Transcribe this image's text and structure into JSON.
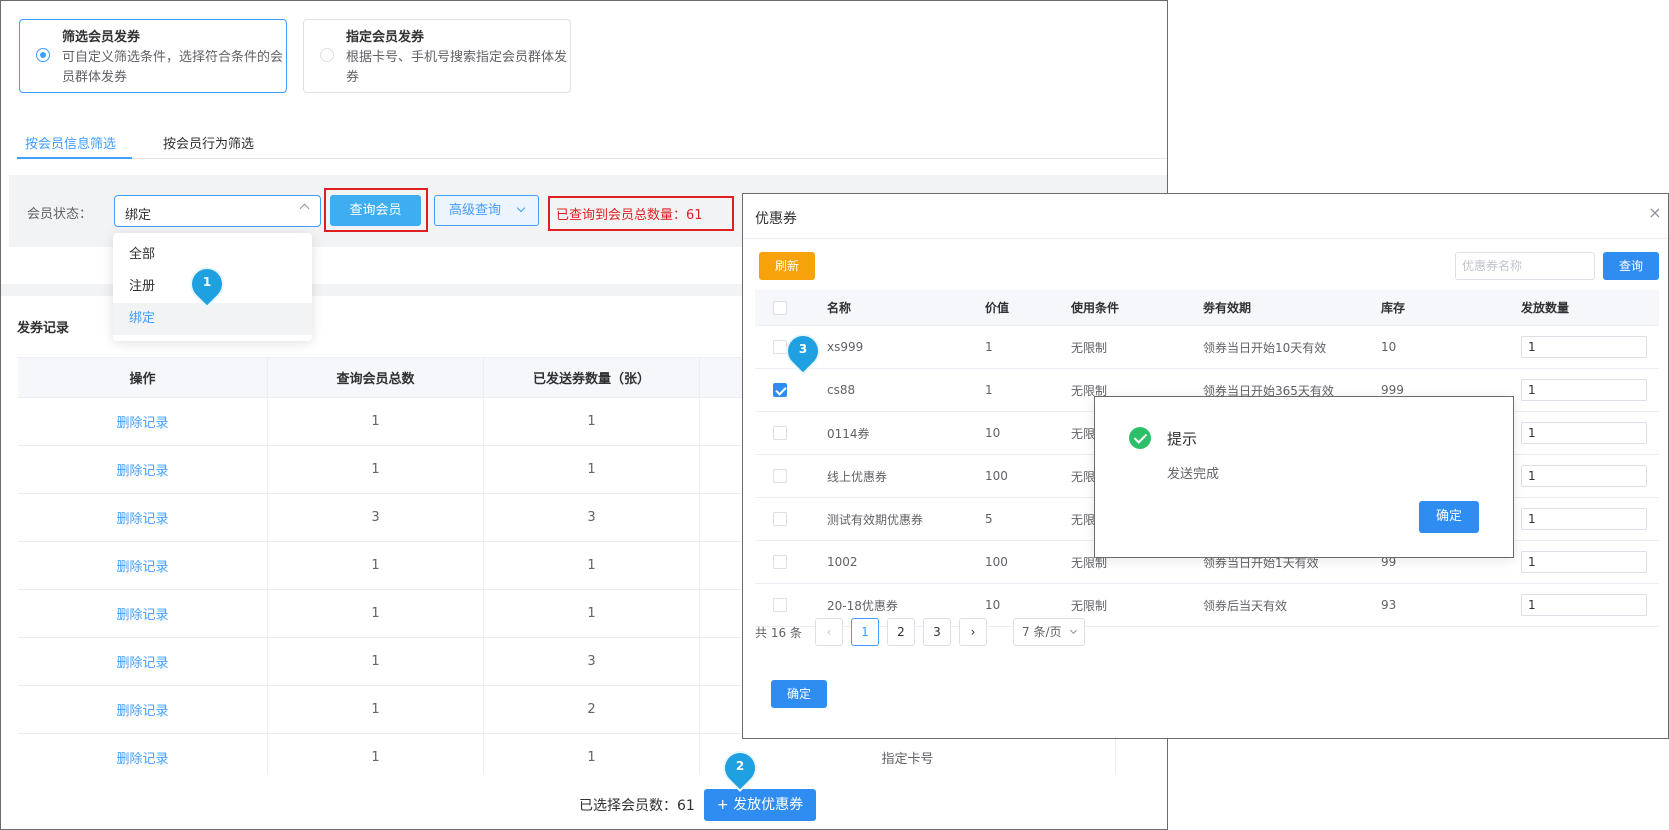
{
  "modes": [
    {
      "title": "筛选会员发券",
      "desc": "可自定义筛选条件，选择符合条件的会员群体发券",
      "selected": true
    },
    {
      "title": "指定会员发券",
      "desc": "根据卡号、手机号搜索指定会员群体发券",
      "selected": false
    }
  ],
  "tabs": [
    "按会员信息筛选",
    "按会员行为筛选"
  ],
  "filter": {
    "status_label": "会员状态：",
    "status_value": "绑定",
    "options": [
      "全部",
      "注册",
      "绑定"
    ],
    "query_button": "查询会员",
    "advanced_button": "高级查询",
    "result_text": "已查询到会员总数量：61"
  },
  "markers": [
    "1",
    "2",
    "3"
  ],
  "records": {
    "title": "发券记录",
    "headers": [
      "操作",
      "查询会员总数",
      "已发送券数量（张）"
    ],
    "rows": [
      {
        "action": "删除记录",
        "total": "1",
        "sent": "1"
      },
      {
        "action": "删除记录",
        "total": "1",
        "sent": "1"
      },
      {
        "action": "删除记录",
        "total": "3",
        "sent": "3"
      },
      {
        "action": "删除记录",
        "total": "1",
        "sent": "1"
      },
      {
        "action": "删除记录",
        "total": "1",
        "sent": "1"
      },
      {
        "action": "删除记录",
        "total": "1",
        "sent": "3"
      },
      {
        "action": "删除记录",
        "total": "1",
        "sent": "2"
      },
      {
        "action": "删除记录",
        "total": "1",
        "sent": "1",
        "extra": "指定卡号"
      }
    ]
  },
  "footer": {
    "selected_text": "已选择会员数：61",
    "send_button": "+ 发放优惠券"
  },
  "coupon_dialog": {
    "title": "优惠券",
    "close": "×",
    "refresh_button": "刷新",
    "search_placeholder": "优惠券名称",
    "search_button": "查询",
    "headers": [
      "名称",
      "价值",
      "使用条件",
      "劵有效期",
      "库存",
      "发放数量"
    ],
    "rows": [
      {
        "name": "xs999",
        "value": "1",
        "condition": "无限制",
        "validity": "领券当日开始10天有效",
        "stock": "10",
        "qty": "1",
        "checked": false
      },
      {
        "name": "cs88",
        "value": "1",
        "condition": "无限制",
        "validity": "领券当日开始365天有效",
        "stock": "999",
        "qty": "1",
        "checked": true
      },
      {
        "name": "0114券",
        "value": "10",
        "condition": "无限",
        "validity": "",
        "stock": "",
        "qty": "1",
        "checked": false
      },
      {
        "name": "线上优惠券",
        "value": "100",
        "condition": "无限",
        "validity": "",
        "stock": "",
        "qty": "1",
        "checked": false
      },
      {
        "name": "测试有效期优惠券",
        "value": "5",
        "condition": "无限",
        "validity": "",
        "stock": "",
        "qty": "1",
        "checked": false
      },
      {
        "name": "1002",
        "value": "100",
        "condition": "无限制",
        "validity": "领券当日开始1天有效",
        "stock": "99",
        "qty": "1",
        "checked": false
      },
      {
        "name": "20-18优惠券",
        "value": "10",
        "condition": "无限制",
        "validity": "领券后当天有效",
        "stock": "93",
        "qty": "1",
        "checked": false
      }
    ],
    "pager": {
      "total": "共 16 条",
      "prev": "‹",
      "pages": [
        "1",
        "2",
        "3"
      ],
      "next": "›",
      "size": "7 条/页"
    },
    "confirm_button": "确定"
  },
  "message_box": {
    "title": "提示",
    "text": "发送完成",
    "ok_button": "确定"
  }
}
